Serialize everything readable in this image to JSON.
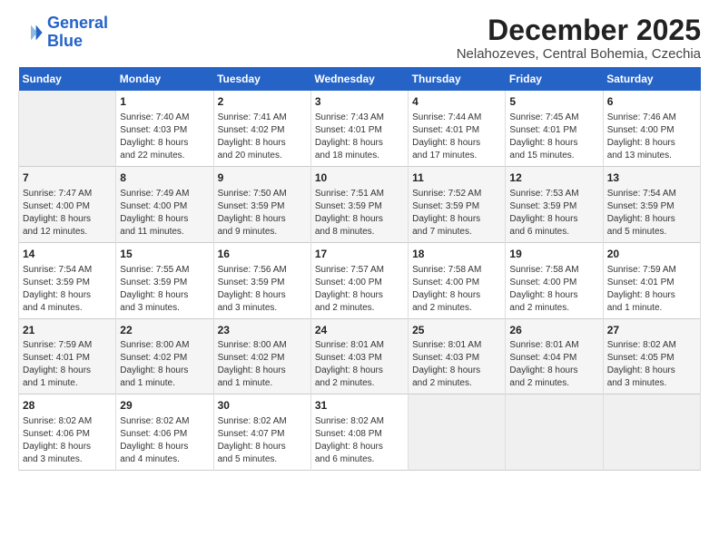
{
  "logo": {
    "line1": "General",
    "line2": "Blue"
  },
  "title": "December 2025",
  "subtitle": "Nelahozeves, Central Bohemia, Czechia",
  "days_of_week": [
    "Sunday",
    "Monday",
    "Tuesday",
    "Wednesday",
    "Thursday",
    "Friday",
    "Saturday"
  ],
  "weeks": [
    [
      {
        "day": "",
        "info": ""
      },
      {
        "day": "1",
        "info": "Sunrise: 7:40 AM\nSunset: 4:03 PM\nDaylight: 8 hours\nand 22 minutes."
      },
      {
        "day": "2",
        "info": "Sunrise: 7:41 AM\nSunset: 4:02 PM\nDaylight: 8 hours\nand 20 minutes."
      },
      {
        "day": "3",
        "info": "Sunrise: 7:43 AM\nSunset: 4:01 PM\nDaylight: 8 hours\nand 18 minutes."
      },
      {
        "day": "4",
        "info": "Sunrise: 7:44 AM\nSunset: 4:01 PM\nDaylight: 8 hours\nand 17 minutes."
      },
      {
        "day": "5",
        "info": "Sunrise: 7:45 AM\nSunset: 4:01 PM\nDaylight: 8 hours\nand 15 minutes."
      },
      {
        "day": "6",
        "info": "Sunrise: 7:46 AM\nSunset: 4:00 PM\nDaylight: 8 hours\nand 13 minutes."
      }
    ],
    [
      {
        "day": "7",
        "info": "Sunrise: 7:47 AM\nSunset: 4:00 PM\nDaylight: 8 hours\nand 12 minutes."
      },
      {
        "day": "8",
        "info": "Sunrise: 7:49 AM\nSunset: 4:00 PM\nDaylight: 8 hours\nand 11 minutes."
      },
      {
        "day": "9",
        "info": "Sunrise: 7:50 AM\nSunset: 3:59 PM\nDaylight: 8 hours\nand 9 minutes."
      },
      {
        "day": "10",
        "info": "Sunrise: 7:51 AM\nSunset: 3:59 PM\nDaylight: 8 hours\nand 8 minutes."
      },
      {
        "day": "11",
        "info": "Sunrise: 7:52 AM\nSunset: 3:59 PM\nDaylight: 8 hours\nand 7 minutes."
      },
      {
        "day": "12",
        "info": "Sunrise: 7:53 AM\nSunset: 3:59 PM\nDaylight: 8 hours\nand 6 minutes."
      },
      {
        "day": "13",
        "info": "Sunrise: 7:54 AM\nSunset: 3:59 PM\nDaylight: 8 hours\nand 5 minutes."
      }
    ],
    [
      {
        "day": "14",
        "info": "Sunrise: 7:54 AM\nSunset: 3:59 PM\nDaylight: 8 hours\nand 4 minutes."
      },
      {
        "day": "15",
        "info": "Sunrise: 7:55 AM\nSunset: 3:59 PM\nDaylight: 8 hours\nand 3 minutes."
      },
      {
        "day": "16",
        "info": "Sunrise: 7:56 AM\nSunset: 3:59 PM\nDaylight: 8 hours\nand 3 minutes."
      },
      {
        "day": "17",
        "info": "Sunrise: 7:57 AM\nSunset: 4:00 PM\nDaylight: 8 hours\nand 2 minutes."
      },
      {
        "day": "18",
        "info": "Sunrise: 7:58 AM\nSunset: 4:00 PM\nDaylight: 8 hours\nand 2 minutes."
      },
      {
        "day": "19",
        "info": "Sunrise: 7:58 AM\nSunset: 4:00 PM\nDaylight: 8 hours\nand 2 minutes."
      },
      {
        "day": "20",
        "info": "Sunrise: 7:59 AM\nSunset: 4:01 PM\nDaylight: 8 hours\nand 1 minute."
      }
    ],
    [
      {
        "day": "21",
        "info": "Sunrise: 7:59 AM\nSunset: 4:01 PM\nDaylight: 8 hours\nand 1 minute."
      },
      {
        "day": "22",
        "info": "Sunrise: 8:00 AM\nSunset: 4:02 PM\nDaylight: 8 hours\nand 1 minute."
      },
      {
        "day": "23",
        "info": "Sunrise: 8:00 AM\nSunset: 4:02 PM\nDaylight: 8 hours\nand 1 minute."
      },
      {
        "day": "24",
        "info": "Sunrise: 8:01 AM\nSunset: 4:03 PM\nDaylight: 8 hours\nand 2 minutes."
      },
      {
        "day": "25",
        "info": "Sunrise: 8:01 AM\nSunset: 4:03 PM\nDaylight: 8 hours\nand 2 minutes."
      },
      {
        "day": "26",
        "info": "Sunrise: 8:01 AM\nSunset: 4:04 PM\nDaylight: 8 hours\nand 2 minutes."
      },
      {
        "day": "27",
        "info": "Sunrise: 8:02 AM\nSunset: 4:05 PM\nDaylight: 8 hours\nand 3 minutes."
      }
    ],
    [
      {
        "day": "28",
        "info": "Sunrise: 8:02 AM\nSunset: 4:06 PM\nDaylight: 8 hours\nand 3 minutes."
      },
      {
        "day": "29",
        "info": "Sunrise: 8:02 AM\nSunset: 4:06 PM\nDaylight: 8 hours\nand 4 minutes."
      },
      {
        "day": "30",
        "info": "Sunrise: 8:02 AM\nSunset: 4:07 PM\nDaylight: 8 hours\nand 5 minutes."
      },
      {
        "day": "31",
        "info": "Sunrise: 8:02 AM\nSunset: 4:08 PM\nDaylight: 8 hours\nand 6 minutes."
      },
      {
        "day": "",
        "info": ""
      },
      {
        "day": "",
        "info": ""
      },
      {
        "day": "",
        "info": ""
      }
    ]
  ]
}
